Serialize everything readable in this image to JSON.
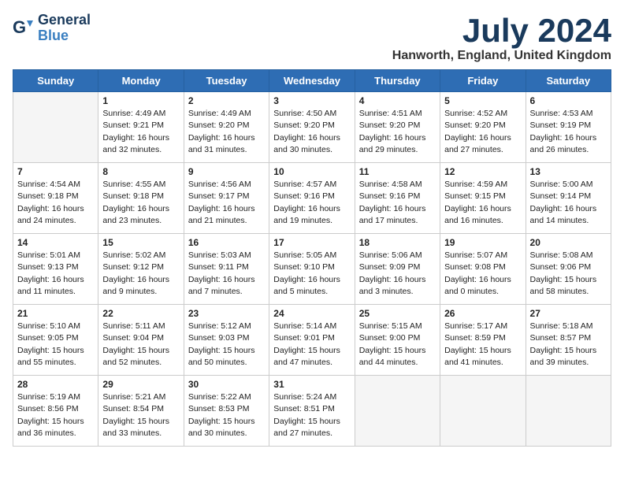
{
  "header": {
    "logo_line1": "General",
    "logo_line2": "Blue",
    "month_title": "July 2024",
    "location": "Hanworth, England, United Kingdom"
  },
  "weekdays": [
    "Sunday",
    "Monday",
    "Tuesday",
    "Wednesday",
    "Thursday",
    "Friday",
    "Saturday"
  ],
  "weeks": [
    [
      {
        "day": "",
        "info": ""
      },
      {
        "day": "1",
        "info": "Sunrise: 4:49 AM\nSunset: 9:21 PM\nDaylight: 16 hours\nand 32 minutes."
      },
      {
        "day": "2",
        "info": "Sunrise: 4:49 AM\nSunset: 9:20 PM\nDaylight: 16 hours\nand 31 minutes."
      },
      {
        "day": "3",
        "info": "Sunrise: 4:50 AM\nSunset: 9:20 PM\nDaylight: 16 hours\nand 30 minutes."
      },
      {
        "day": "4",
        "info": "Sunrise: 4:51 AM\nSunset: 9:20 PM\nDaylight: 16 hours\nand 29 minutes."
      },
      {
        "day": "5",
        "info": "Sunrise: 4:52 AM\nSunset: 9:20 PM\nDaylight: 16 hours\nand 27 minutes."
      },
      {
        "day": "6",
        "info": "Sunrise: 4:53 AM\nSunset: 9:19 PM\nDaylight: 16 hours\nand 26 minutes."
      }
    ],
    [
      {
        "day": "7",
        "info": "Sunrise: 4:54 AM\nSunset: 9:18 PM\nDaylight: 16 hours\nand 24 minutes."
      },
      {
        "day": "8",
        "info": "Sunrise: 4:55 AM\nSunset: 9:18 PM\nDaylight: 16 hours\nand 23 minutes."
      },
      {
        "day": "9",
        "info": "Sunrise: 4:56 AM\nSunset: 9:17 PM\nDaylight: 16 hours\nand 21 minutes."
      },
      {
        "day": "10",
        "info": "Sunrise: 4:57 AM\nSunset: 9:16 PM\nDaylight: 16 hours\nand 19 minutes."
      },
      {
        "day": "11",
        "info": "Sunrise: 4:58 AM\nSunset: 9:16 PM\nDaylight: 16 hours\nand 17 minutes."
      },
      {
        "day": "12",
        "info": "Sunrise: 4:59 AM\nSunset: 9:15 PM\nDaylight: 16 hours\nand 16 minutes."
      },
      {
        "day": "13",
        "info": "Sunrise: 5:00 AM\nSunset: 9:14 PM\nDaylight: 16 hours\nand 14 minutes."
      }
    ],
    [
      {
        "day": "14",
        "info": "Sunrise: 5:01 AM\nSunset: 9:13 PM\nDaylight: 16 hours\nand 11 minutes."
      },
      {
        "day": "15",
        "info": "Sunrise: 5:02 AM\nSunset: 9:12 PM\nDaylight: 16 hours\nand 9 minutes."
      },
      {
        "day": "16",
        "info": "Sunrise: 5:03 AM\nSunset: 9:11 PM\nDaylight: 16 hours\nand 7 minutes."
      },
      {
        "day": "17",
        "info": "Sunrise: 5:05 AM\nSunset: 9:10 PM\nDaylight: 16 hours\nand 5 minutes."
      },
      {
        "day": "18",
        "info": "Sunrise: 5:06 AM\nSunset: 9:09 PM\nDaylight: 16 hours\nand 3 minutes."
      },
      {
        "day": "19",
        "info": "Sunrise: 5:07 AM\nSunset: 9:08 PM\nDaylight: 16 hours\nand 0 minutes."
      },
      {
        "day": "20",
        "info": "Sunrise: 5:08 AM\nSunset: 9:06 PM\nDaylight: 15 hours\nand 58 minutes."
      }
    ],
    [
      {
        "day": "21",
        "info": "Sunrise: 5:10 AM\nSunset: 9:05 PM\nDaylight: 15 hours\nand 55 minutes."
      },
      {
        "day": "22",
        "info": "Sunrise: 5:11 AM\nSunset: 9:04 PM\nDaylight: 15 hours\nand 52 minutes."
      },
      {
        "day": "23",
        "info": "Sunrise: 5:12 AM\nSunset: 9:03 PM\nDaylight: 15 hours\nand 50 minutes."
      },
      {
        "day": "24",
        "info": "Sunrise: 5:14 AM\nSunset: 9:01 PM\nDaylight: 15 hours\nand 47 minutes."
      },
      {
        "day": "25",
        "info": "Sunrise: 5:15 AM\nSunset: 9:00 PM\nDaylight: 15 hours\nand 44 minutes."
      },
      {
        "day": "26",
        "info": "Sunrise: 5:17 AM\nSunset: 8:59 PM\nDaylight: 15 hours\nand 41 minutes."
      },
      {
        "day": "27",
        "info": "Sunrise: 5:18 AM\nSunset: 8:57 PM\nDaylight: 15 hours\nand 39 minutes."
      }
    ],
    [
      {
        "day": "28",
        "info": "Sunrise: 5:19 AM\nSunset: 8:56 PM\nDaylight: 15 hours\nand 36 minutes."
      },
      {
        "day": "29",
        "info": "Sunrise: 5:21 AM\nSunset: 8:54 PM\nDaylight: 15 hours\nand 33 minutes."
      },
      {
        "day": "30",
        "info": "Sunrise: 5:22 AM\nSunset: 8:53 PM\nDaylight: 15 hours\nand 30 minutes."
      },
      {
        "day": "31",
        "info": "Sunrise: 5:24 AM\nSunset: 8:51 PM\nDaylight: 15 hours\nand 27 minutes."
      },
      {
        "day": "",
        "info": ""
      },
      {
        "day": "",
        "info": ""
      },
      {
        "day": "",
        "info": ""
      }
    ]
  ]
}
